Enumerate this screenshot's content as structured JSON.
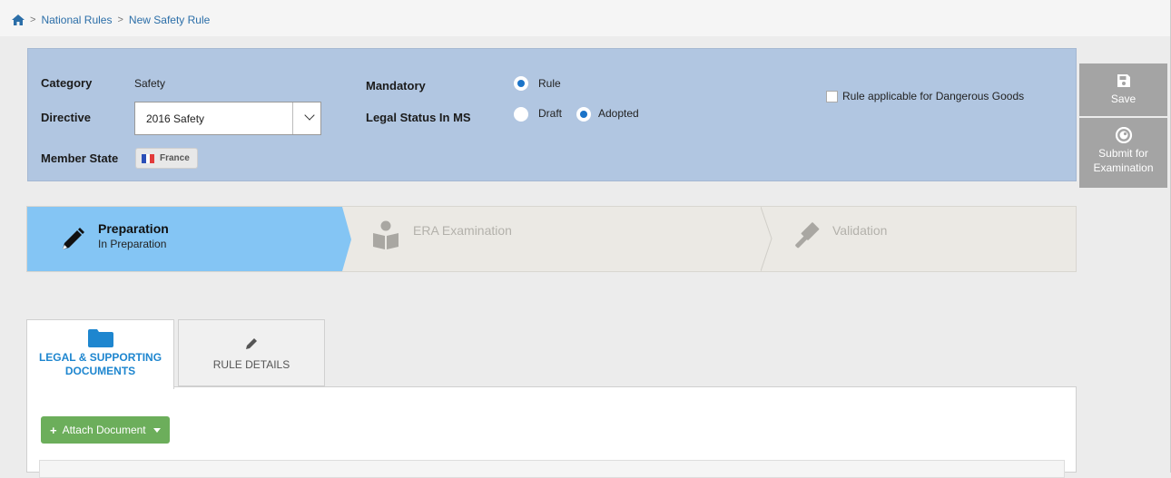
{
  "breadcrumb": {
    "home_icon": "home-icon",
    "items": [
      "National Rules",
      "New Safety Rule"
    ]
  },
  "rule_info": {
    "category_label": "Category",
    "category_value": "Safety",
    "directive_label": "Directive",
    "directive_value": "2016 Safety",
    "member_state_label": "Member State",
    "member_state_value": "France",
    "mandatory_label": "Mandatory",
    "mandatory_option": "Rule",
    "legal_status_label": "Legal Status In MS",
    "legal_status_options": [
      "Draft",
      "Adopted"
    ],
    "legal_status_selected": "Adopted",
    "dangerous_goods_label": "Rule applicable for Dangerous Goods",
    "dangerous_goods_checked": false
  },
  "side_actions": {
    "save_label": "Save",
    "submit_label_line1": "Submit for",
    "submit_label_line2": "Examination"
  },
  "steps": [
    {
      "title": "Preparation",
      "subtitle": "In Preparation",
      "icon": "pencil-icon",
      "active": true
    },
    {
      "title": "ERA Examination",
      "icon": "reader-icon",
      "active": false
    },
    {
      "title": "Validation",
      "icon": "gavel-icon",
      "active": false
    }
  ],
  "tabs": [
    {
      "label_line1": "LEGAL & SUPPORTING",
      "label_line2": "DOCUMENTS",
      "icon": "folder-icon",
      "active": true
    },
    {
      "label": "RULE DETAILS",
      "icon": "pencil-icon",
      "active": false
    }
  ],
  "content": {
    "attach_label": "Attach Document"
  },
  "colors": {
    "panel": "#b1c6e1",
    "active_step": "#84c5f4",
    "accent": "#1e86cf",
    "attach": "#6cae5b",
    "side_button": "#a4a4a4"
  }
}
